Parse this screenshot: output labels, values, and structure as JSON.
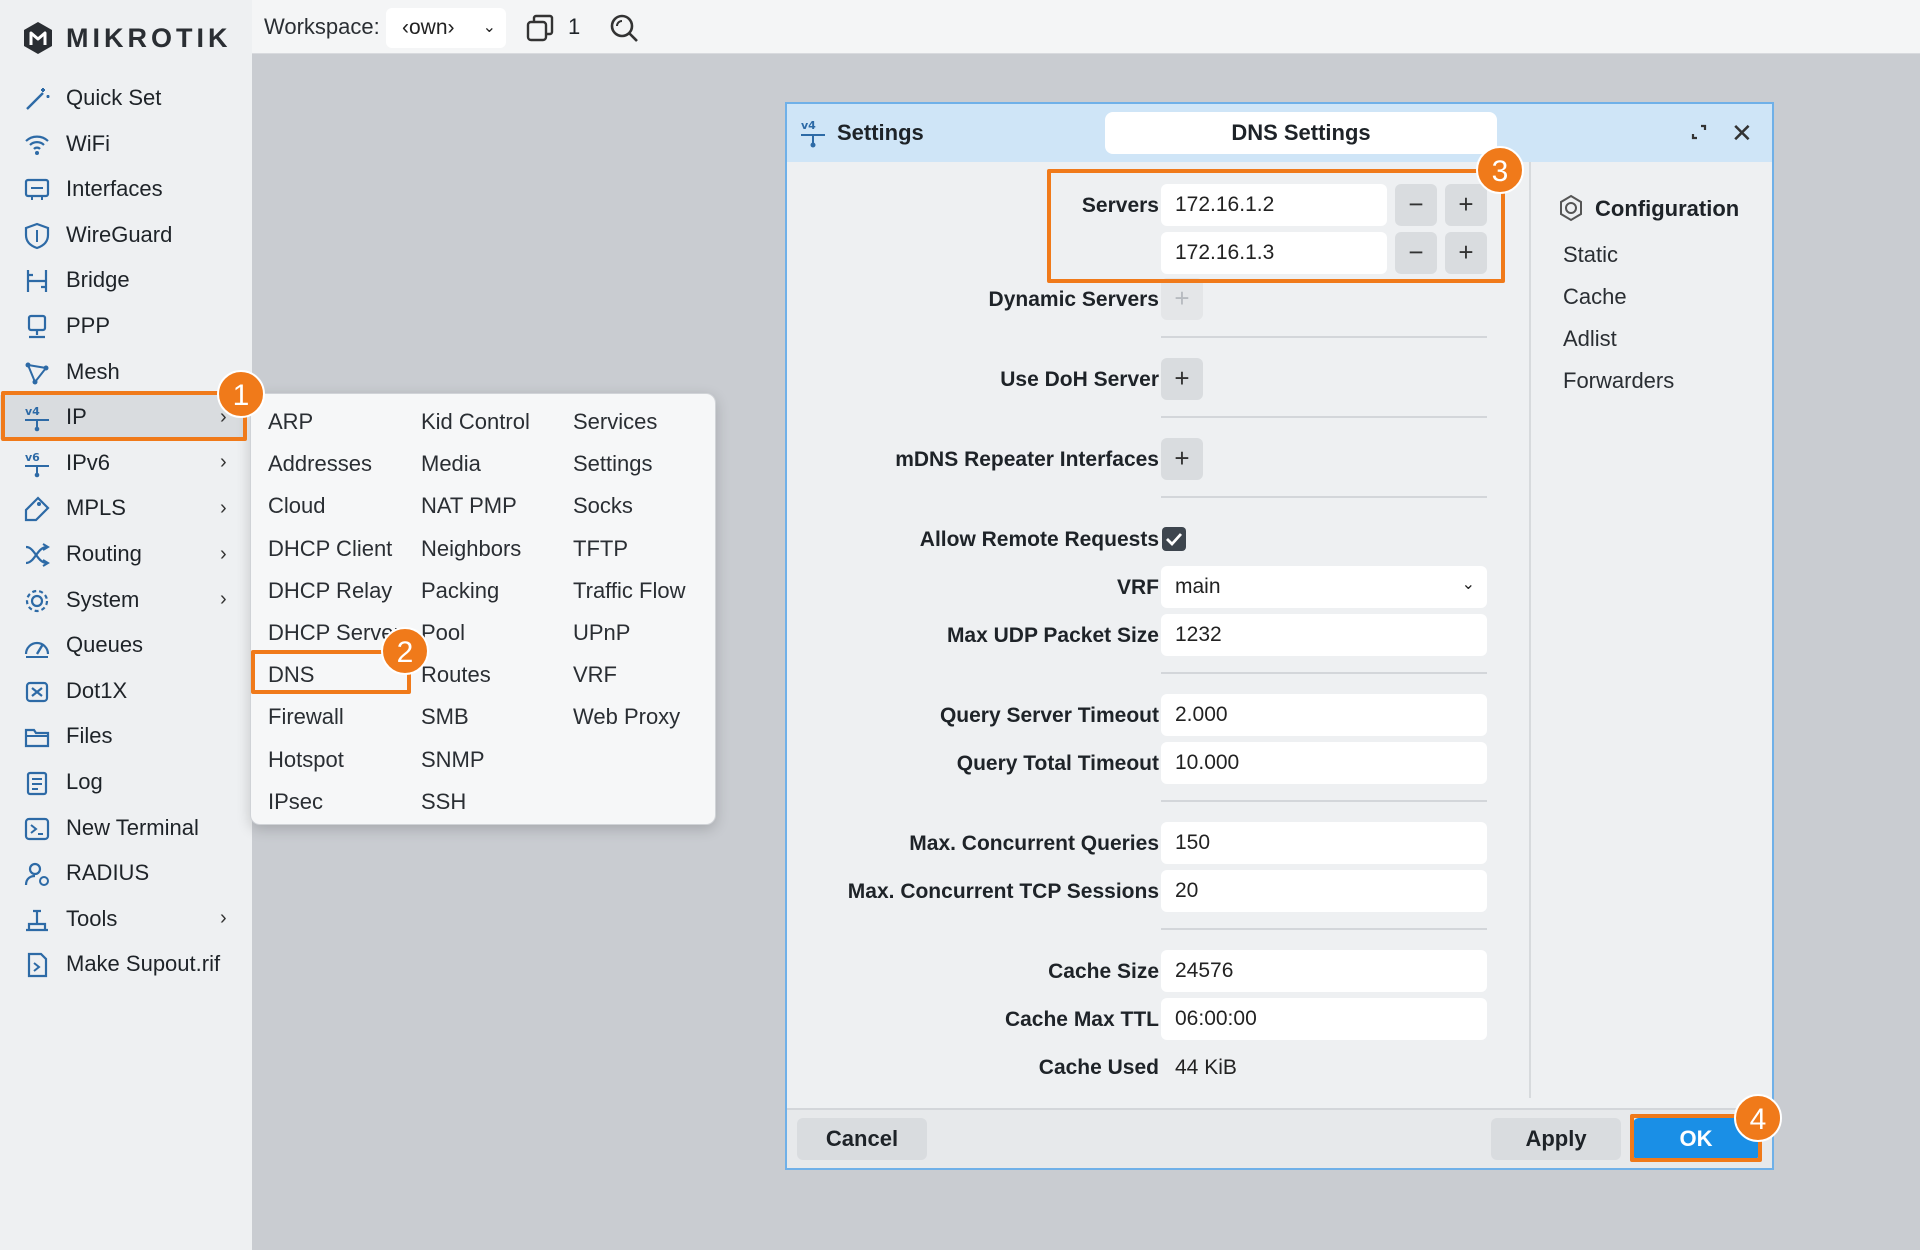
{
  "brand": {
    "name": "MIKROTIK"
  },
  "sidebar": {
    "items": [
      {
        "label": "Quick Set",
        "icon": "magic-wand-icon",
        "submenu": false
      },
      {
        "label": "WiFi",
        "icon": "wifi-icon",
        "submenu": false
      },
      {
        "label": "Interfaces",
        "icon": "ethernet-port-icon",
        "submenu": false
      },
      {
        "label": "WireGuard",
        "icon": "shield-icon",
        "submenu": false
      },
      {
        "label": "Bridge",
        "icon": "bridge-icon",
        "submenu": false
      },
      {
        "label": "PPP",
        "icon": "ppp-icon",
        "submenu": false
      },
      {
        "label": "Mesh",
        "icon": "mesh-icon",
        "submenu": false
      },
      {
        "label": "IP",
        "icon": "ipv4-icon",
        "submenu": true
      },
      {
        "label": "IPv6",
        "icon": "ipv6-icon",
        "submenu": true
      },
      {
        "label": "MPLS",
        "icon": "tag-icon",
        "submenu": true
      },
      {
        "label": "Routing",
        "icon": "routing-icon",
        "submenu": true
      },
      {
        "label": "System",
        "icon": "gear-icon",
        "submenu": true
      },
      {
        "label": "Queues",
        "icon": "gauge-icon",
        "submenu": false
      },
      {
        "label": "Dot1X",
        "icon": "dot1x-icon",
        "submenu": false
      },
      {
        "label": "Files",
        "icon": "folder-icon",
        "submenu": false
      },
      {
        "label": "Log",
        "icon": "log-icon",
        "submenu": false
      },
      {
        "label": "New Terminal",
        "icon": "terminal-icon",
        "submenu": false
      },
      {
        "label": "RADIUS",
        "icon": "radius-icon",
        "submenu": false
      },
      {
        "label": "Tools",
        "icon": "tools-icon",
        "submenu": true
      },
      {
        "label": "Make Supout.rif",
        "icon": "supout-icon",
        "submenu": false
      }
    ],
    "active": "IP"
  },
  "topbar": {
    "workspace_label": "Workspace:",
    "workspace_value": "‹own›",
    "windows_count": "1"
  },
  "ip_menu": {
    "columns": [
      [
        "ARP",
        "Addresses",
        "Cloud",
        "DHCP Client",
        "DHCP Relay",
        "DHCP Server",
        "DNS",
        "Firewall",
        "Hotspot",
        "IPsec"
      ],
      [
        "Kid Control",
        "Media",
        "NAT PMP",
        "Neighbors",
        "Packing",
        "Pool",
        "Routes",
        "SMB",
        "SNMP",
        "SSH"
      ],
      [
        "Services",
        "Settings",
        "Socks",
        "TFTP",
        "Traffic Flow",
        "UPnP",
        "VRF",
        "Web Proxy"
      ]
    ]
  },
  "dialog": {
    "title": "Settings",
    "tab": "DNS Settings",
    "servers_label": "Servers",
    "servers": [
      "172.16.1.2",
      "172.16.1.3"
    ],
    "dynamic_servers_label": "Dynamic Servers",
    "use_doh_label": "Use DoH Server",
    "mdns_label": "mDNS Repeater Interfaces",
    "allow_remote_label": "Allow Remote Requests",
    "allow_remote_checked": true,
    "vrf_label": "VRF",
    "vrf_value": "main",
    "max_udp_label": "Max UDP Packet Size",
    "max_udp_value": "1232",
    "query_server_timeout_label": "Query Server Timeout",
    "query_server_timeout_value": "2.000",
    "query_total_timeout_label": "Query Total Timeout",
    "query_total_timeout_value": "10.000",
    "max_concurrent_queries_label": "Max. Concurrent Queries",
    "max_concurrent_queries_value": "150",
    "max_concurrent_tcp_label": "Max. Concurrent TCP Sessions",
    "max_concurrent_tcp_value": "20",
    "cache_size_label": "Cache Size",
    "cache_size_value": "24576",
    "cache_max_ttl_label": "Cache Max TTL",
    "cache_max_ttl_value": "06:00:00",
    "cache_used_label": "Cache Used",
    "cache_used_value": "44 KiB",
    "side": {
      "heading": "Configuration",
      "links": [
        "Static",
        "Cache",
        "Adlist",
        "Forwarders"
      ]
    },
    "buttons": {
      "cancel": "Cancel",
      "apply": "Apply",
      "ok": "OK"
    }
  },
  "annotations": {
    "badge1": "1",
    "badge2": "2",
    "badge3": "3",
    "badge4": "4"
  },
  "colors": {
    "accent": "#f07a1a",
    "primary": "#1a8fe6",
    "header": "#cfe5f7",
    "icon": "#2d6aa6"
  }
}
